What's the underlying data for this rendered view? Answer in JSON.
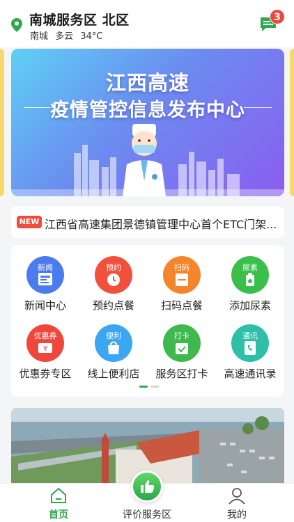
{
  "header": {
    "area_name": "南城服务区  北区",
    "weather_city": "南城",
    "weather_condition": "多云",
    "weather_temp": "34°C",
    "message_count": "3"
  },
  "banner": {
    "title_line1": "江西高速",
    "title_line2": "疫情管控信息发布中心"
  },
  "ticker": {
    "tag": "NEW",
    "text": "江西省高速集团景德镇管理中心首个ETC门架..."
  },
  "services": [
    {
      "label": "新闻中心",
      "icon_top": "新闻",
      "icon": "news-icon",
      "color": "#4a7cf0"
    },
    {
      "label": "预约点餐",
      "icon_top": "预约",
      "icon": "alarm-clock-icon",
      "color": "#f0503c"
    },
    {
      "label": "扫码点餐",
      "icon_top": "扫码",
      "icon": "scan-icon",
      "color": "#f5852a"
    },
    {
      "label": "添加尿素",
      "icon_top": "尿素",
      "icon": "urea-bottle-icon",
      "color": "#3cbf4a"
    },
    {
      "label": "优惠券专区",
      "icon_top": "优惠券",
      "icon": "coupon-icon",
      "color": "#f0463c"
    },
    {
      "label": "线上便利店",
      "icon_top": "便利",
      "icon": "shopping-bag-icon",
      "color": "#3aa7f0"
    },
    {
      "label": "服务区打卡",
      "icon_top": "打卡",
      "icon": "calendar-check-icon",
      "color": "#3fb84e"
    },
    {
      "label": "高速通讯录",
      "icon_top": "通讯",
      "icon": "phone-book-icon",
      "color": "#2fbfa8"
    }
  ],
  "bottom_nav": {
    "home": "首页",
    "rate": "评价服务区",
    "mine": "我的"
  },
  "colors": {
    "accent_green": "#2fa84f",
    "badge_red": "#f0463c"
  }
}
